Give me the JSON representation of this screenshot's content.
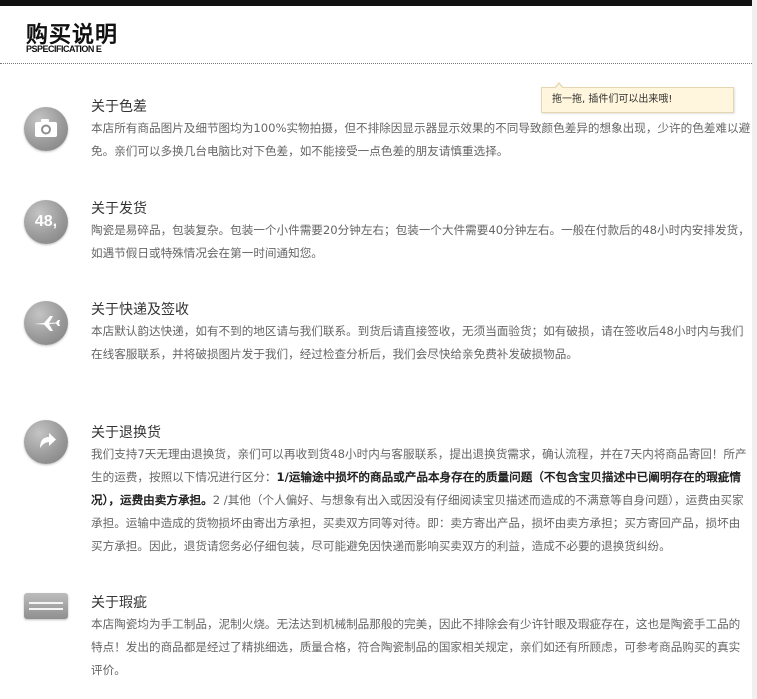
{
  "header": {
    "title": "购买说明",
    "subtitle": "PSPECIFICATION E"
  },
  "tooltip": {
    "text": "拖一拖, 插件们可以出来哦!"
  },
  "sections": [
    {
      "icon": "camera-icon",
      "heading": "关于色差",
      "text": "本店所有商品图片及细节图均为100%实物拍摄，但不排除因显示器显示效果的不同导致颜色差异的想象出现，少许的色差难以避免。亲们可以多换几台电脑比对下色差，如不能接受一点色差的朋友请慎重选择。"
    },
    {
      "icon": "48-hours-icon",
      "icon_label": "48,",
      "heading": "关于发货",
      "text": "陶瓷是易碎品，包装复杂。包装一个小件需要20分钟左右；包装一个大件需要40分钟左右。一般在付款后的48小时内安排发货，如遇节假日或特殊情况会在第一时间通知您。"
    },
    {
      "icon": "airplane-icon",
      "heading": "关于快递及签收",
      "text": "本店默认韵达快递，如有不到的地区请与我们联系。到货后请直接签收，无须当面验货；如有破损，请在签收后48小时内与我们在线客服联系，并将破损图片发于我们，经过检查分析后，我们会尽快给亲免费补发破损物品。"
    },
    {
      "icon": "return-arrow-icon",
      "heading": "关于退换货",
      "text_a": "我们支持7天无理由退换货，亲们可以再收到货48小时内与客服联系，提出退换货需求，确认流程，并在7天内将商品寄回！所产生的运费，按照以下情况进行区分：",
      "text_bold_a": "1/运输途中损坏的商品或产品本身存在的质量问题（不包含宝贝描述中已阐明存在的瑕疵情况），运费由卖方承担。",
      "text_b": "2 /其他（个人偏好、与想象有出入或因没有仔细阅读宝贝描述而造成的不满意等自身问题），运费由买家承担。运输中造成的货物损坏由寄出方承担，买卖双方同等对待。即：卖方寄出产品，损坏由卖方承担；买方寄回产品，损坏由买方承担。因此，退货请您务必仔细包装，尽可能避免因快递而影响买卖双方的利益，造成不必要的退换货纠纷。"
    },
    {
      "icon": "box-icon",
      "heading": "关于瑕疵",
      "text": "本店陶瓷均为手工制品，泥制火烧。无法达到机械制品那般的完美，因此不排除会有少许针眼及瑕疵存在，这也是陶瓷手工品的特点！发出的商品都是经过了精挑细选，质量合格，符合陶瓷制品的国家相关规定，亲们如还有所顾虑，可参考商品购买的真实评价。"
    }
  ]
}
